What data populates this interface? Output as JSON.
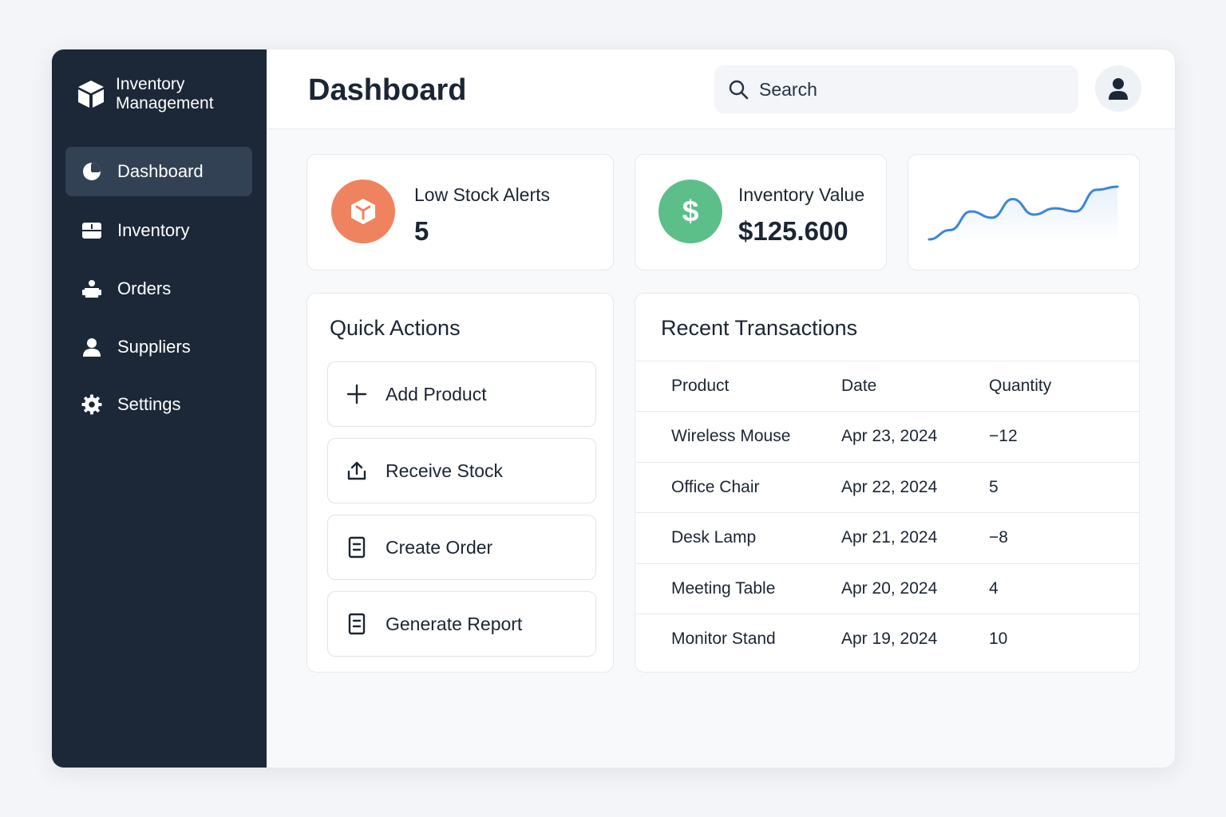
{
  "app": {
    "brand_line1": "Inventory",
    "brand_line2": "Management"
  },
  "sidebar": {
    "items": [
      {
        "label": "Dashboard",
        "icon": "pie-chart-icon",
        "active": true
      },
      {
        "label": "Inventory",
        "icon": "box-icon",
        "active": false
      },
      {
        "label": "Orders",
        "icon": "orders-icon",
        "active": false
      },
      {
        "label": "Suppliers",
        "icon": "user-icon",
        "active": false
      },
      {
        "label": "Settings",
        "icon": "gear-icon",
        "active": false
      }
    ]
  },
  "header": {
    "title": "Dashboard",
    "search_placeholder": "Search"
  },
  "stats": {
    "low_stock": {
      "label": "Low Stock Alerts",
      "value": "5",
      "icon": "cube-icon",
      "color": "#f0835f"
    },
    "inventory_value": {
      "label": "Inventory Value",
      "value": "$125.600",
      "icon": "dollar-icon",
      "color": "#5cbf8a"
    }
  },
  "sparkline": {
    "color": "#3b86d6",
    "values": [
      2,
      5,
      11,
      9,
      15,
      10,
      12,
      11,
      18,
      19
    ]
  },
  "quick_actions": {
    "title": "Quick Actions",
    "items": [
      {
        "label": "Add Product",
        "icon": "plus-icon"
      },
      {
        "label": "Receive Stock",
        "icon": "upload-icon"
      },
      {
        "label": "Create Order",
        "icon": "document-icon"
      },
      {
        "label": "Generate Report",
        "icon": "report-icon"
      }
    ]
  },
  "transactions": {
    "title": "Recent Transactions",
    "columns": [
      "Product",
      "Date",
      "Quantity"
    ],
    "rows": [
      [
        "Wireless Mouse",
        "Apr 23, 2024",
        "−12"
      ],
      [
        "Office Chair",
        "Apr 22, 2024",
        "5"
      ],
      [
        "Desk Lamp",
        "Apr 21, 2024",
        "−8"
      ],
      [
        "Meeting Table",
        "Apr 20, 2024",
        "4"
      ],
      [
        "Monitor Stand",
        "Apr 19, 2024",
        "10"
      ]
    ]
  }
}
